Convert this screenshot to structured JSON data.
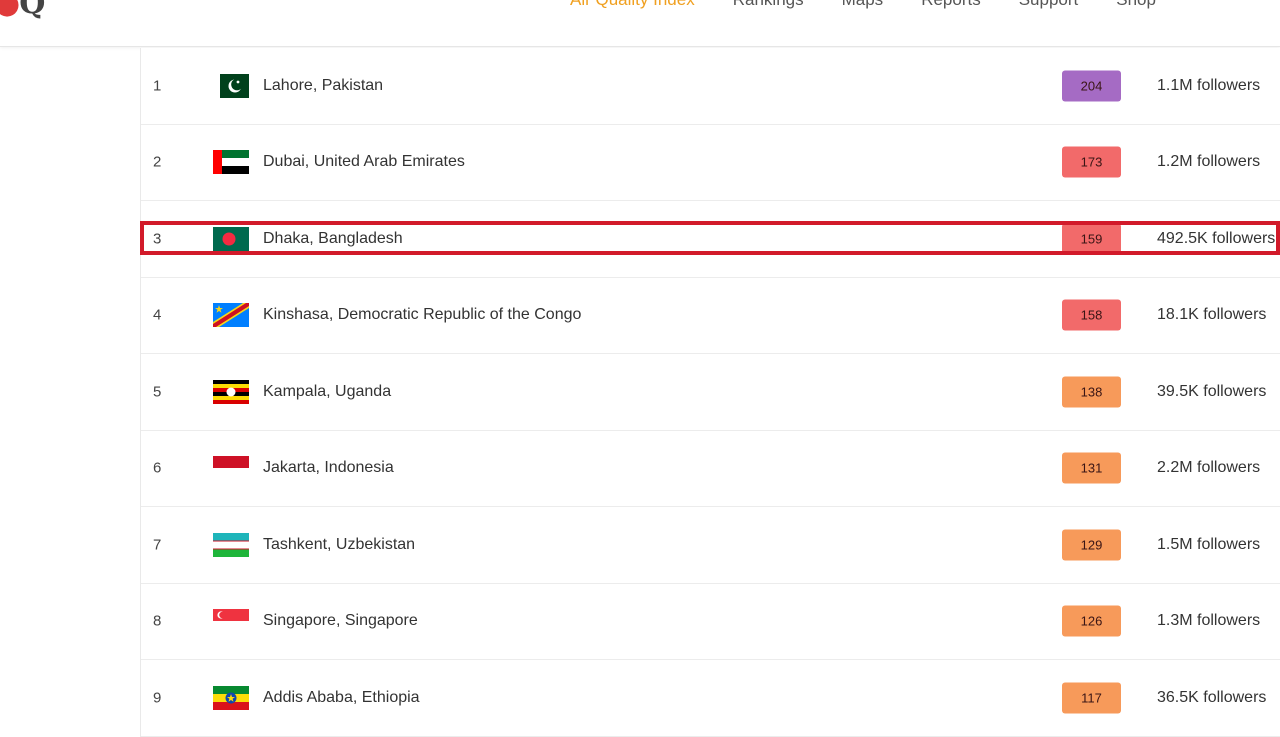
{
  "header": {
    "logo_text": "Q",
    "nav_items": [
      {
        "label": "Air Quality Index",
        "active": true
      },
      {
        "label": "Rankings",
        "active": false
      },
      {
        "label": "Maps",
        "active": false
      },
      {
        "label": "Reports",
        "active": false
      },
      {
        "label": "Support",
        "active": false
      },
      {
        "label": "Shop",
        "active": false
      }
    ]
  },
  "colors": {
    "score_purple": "#a56bc4",
    "score_red": "#f26a6a",
    "score_orange": "#f79a5a",
    "highlight_border": "#d21a2a"
  },
  "rows": [
    {
      "rank": "1",
      "flag": "pakistan-flag-icon",
      "city": "Lahore, Pakistan",
      "score": "204",
      "score_color": "#a56bc4",
      "followers": "1.1M followers"
    },
    {
      "rank": "2",
      "flag": "uae-flag-icon",
      "city": "Dubai, United Arab Emirates",
      "score": "173",
      "score_color": "#f26a6a",
      "followers": "1.2M followers"
    },
    {
      "rank": "3",
      "flag": "bangladesh-flag-icon",
      "city": "Dhaka, Bangladesh",
      "score": "159",
      "score_color": "#f26a6a",
      "followers": "492.5K followers",
      "highlighted": true
    },
    {
      "rank": "4",
      "flag": "drc-flag-icon",
      "city": "Kinshasa, Democratic Republic of the Congo",
      "score": "158",
      "score_color": "#f26a6a",
      "followers": "18.1K followers"
    },
    {
      "rank": "5",
      "flag": "uganda-flag-icon",
      "city": "Kampala, Uganda",
      "score": "138",
      "score_color": "#f79a5a",
      "followers": "39.5K followers"
    },
    {
      "rank": "6",
      "flag": "indonesia-flag-icon",
      "city": "Jakarta, Indonesia",
      "score": "131",
      "score_color": "#f79a5a",
      "followers": "2.2M followers"
    },
    {
      "rank": "7",
      "flag": "uzbekistan-flag-icon",
      "city": "Tashkent, Uzbekistan",
      "score": "129",
      "score_color": "#f79a5a",
      "followers": "1.5M followers"
    },
    {
      "rank": "8",
      "flag": "singapore-flag-icon",
      "city": "Singapore, Singapore",
      "score": "126",
      "score_color": "#f79a5a",
      "followers": "1.3M followers"
    },
    {
      "rank": "9",
      "flag": "ethiopia-flag-icon",
      "city": "Addis Ababa, Ethiopia",
      "score": "117",
      "score_color": "#f79a5a",
      "followers": "36.5K followers"
    }
  ]
}
